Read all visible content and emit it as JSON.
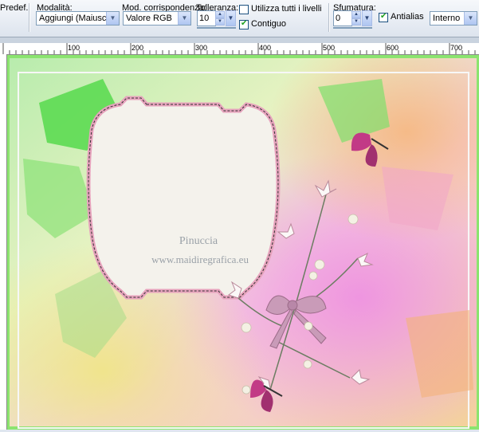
{
  "toolbar": {
    "preset_label": "Predef.:",
    "mode": {
      "label": "Modalità:",
      "value": "Aggiungi (Maiusc)"
    },
    "match_mode": {
      "label": "Mod. corrispondenza:",
      "value": "Valore RGB"
    },
    "tolerance": {
      "label": "Tolleranza:",
      "value": "10"
    },
    "use_all_layers": {
      "label": "Utilizza tutti i livelli",
      "checked": false
    },
    "contiguous": {
      "label": "Contiguo",
      "checked": true
    },
    "feather": {
      "label": "Sfumatura:",
      "value": "0"
    },
    "antialias": {
      "label": "Antialias",
      "checked": true
    },
    "antialias_mode": {
      "value": "Interno"
    }
  },
  "ruler": {
    "labels": [
      "100",
      "200",
      "300",
      "400",
      "500",
      "600",
      "700"
    ]
  },
  "canvas": {
    "watermark_line1": "Pinuccia",
    "watermark_line2": "www.maidiregrafica.eu"
  },
  "colors": {
    "toolbar_bg": "#dde4ee",
    "frame_pink": "#d88aa8",
    "label_cream": "#f2f0ea",
    "green": "#5ee25c",
    "magenta": "#e67ad8"
  }
}
